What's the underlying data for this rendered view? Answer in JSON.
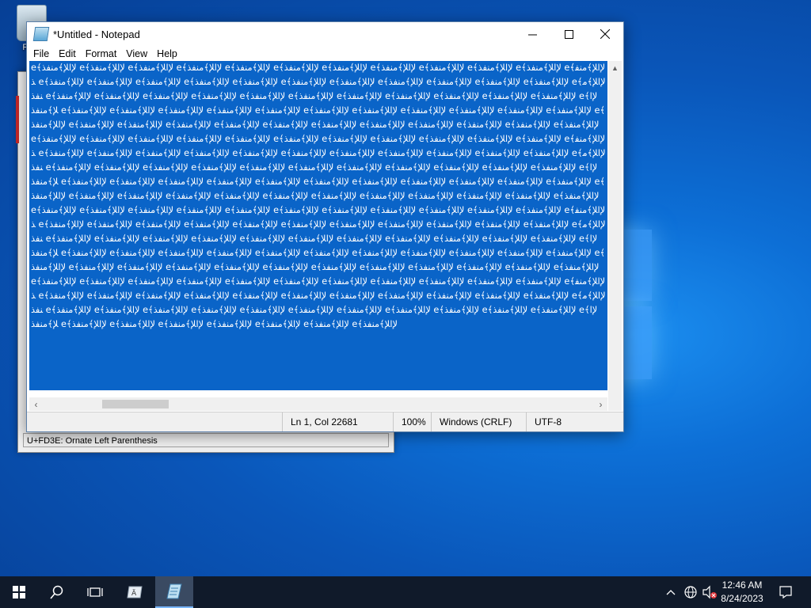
{
  "desktop": {
    "recycle_bin_label": "Re..."
  },
  "charmap": {
    "status_text": "U+FD3E: Ornate Left Parenthesis"
  },
  "notepad": {
    "title": "*Untitled - Notepad",
    "menu": [
      "File",
      "Edit",
      "Format",
      "View",
      "Help"
    ],
    "content_unit": "e﴾ﻹﺍﻺ﴾ﻣﻨﻔﺬ  ",
    "status": {
      "position": "Ln 1, Col 22681",
      "zoom": "100%",
      "line_ending": "Windows (CRLF)",
      "encoding": "UTF-8"
    }
  },
  "taskbar": {
    "clock_time": "12:46 AM",
    "clock_date": "8/24/2023"
  }
}
